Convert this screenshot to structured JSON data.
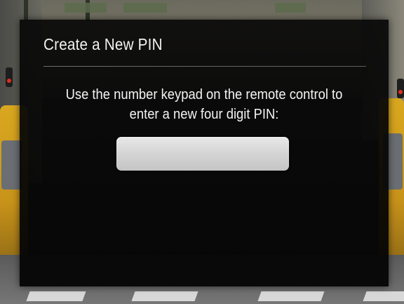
{
  "dialog": {
    "title": "Create a New PIN",
    "instructions": "Use the number keypad on the remote control to enter a new four digit PIN:",
    "pin_value": ""
  },
  "colors": {
    "dialog_background": "#080808",
    "text": "#f2f2f2",
    "pin_field": "#d6d6d6",
    "taxi_yellow": "#d9a81f"
  }
}
